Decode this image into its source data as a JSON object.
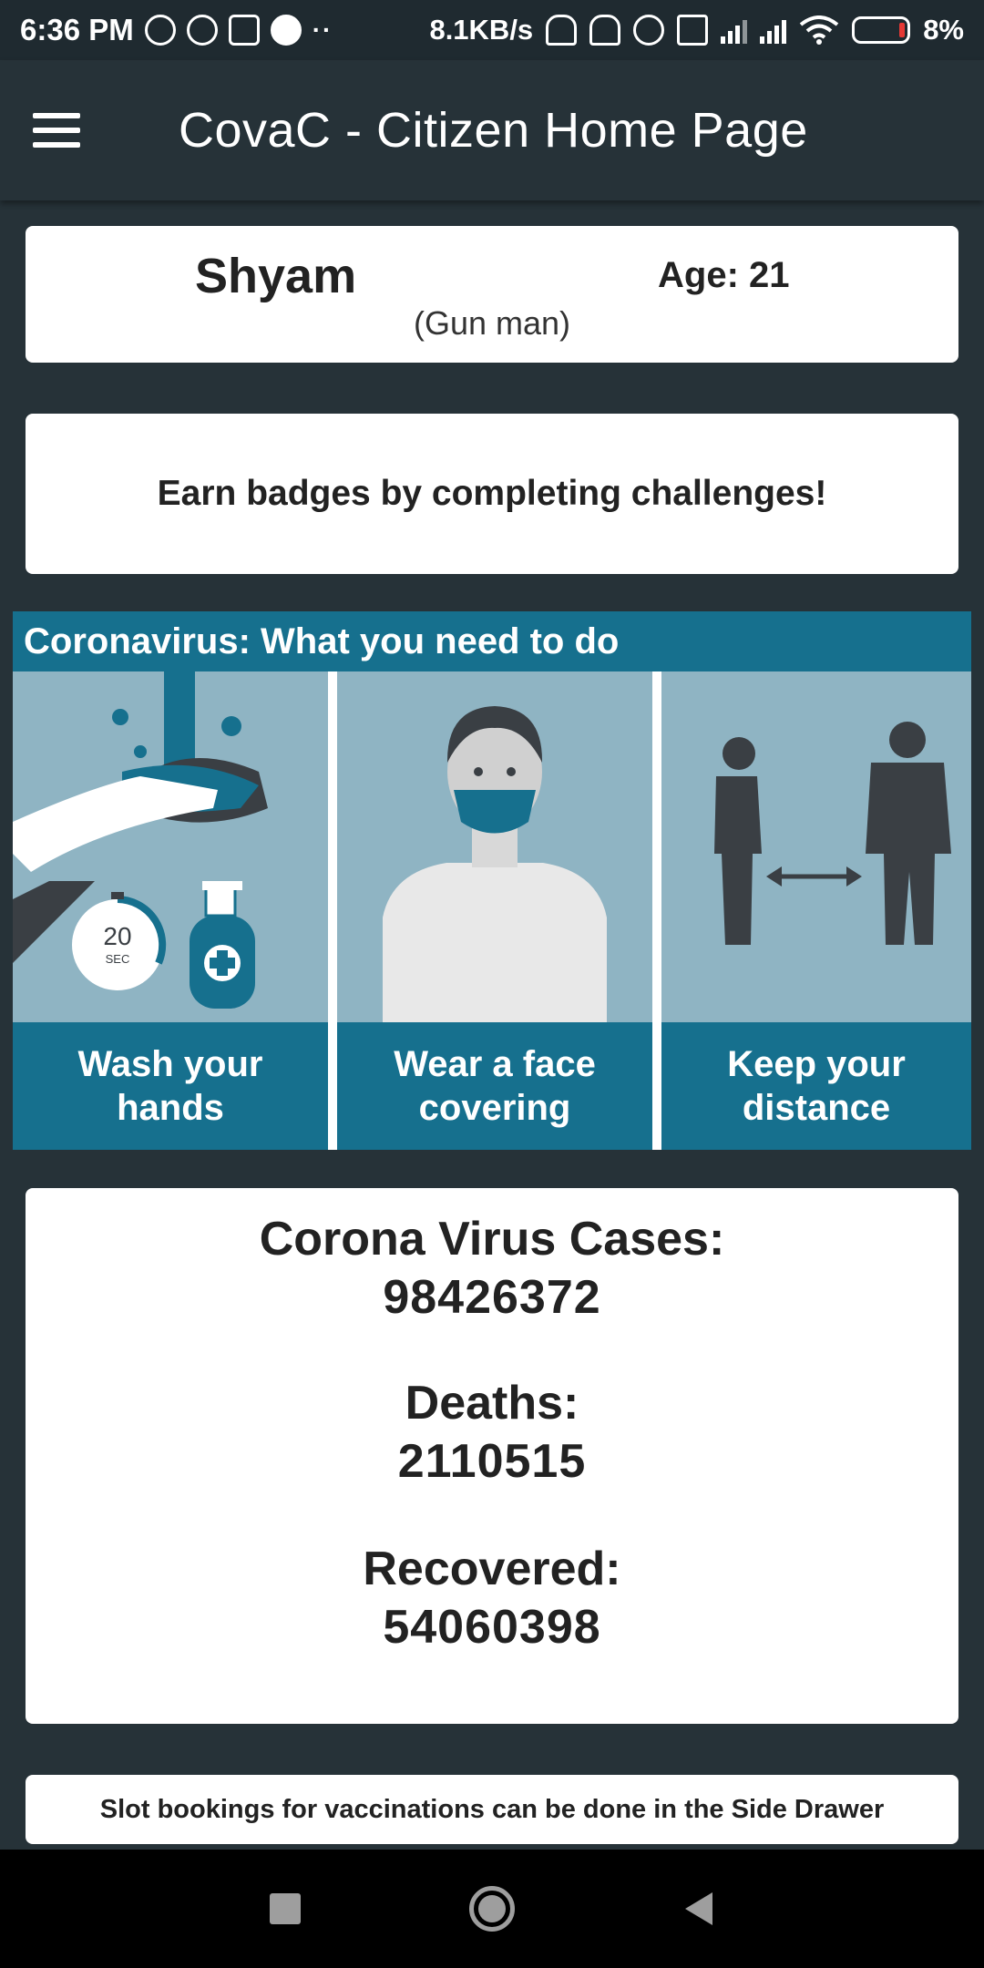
{
  "status_bar": {
    "time": "6:36 PM",
    "dots": "··",
    "net_speed": "8.1KB/s",
    "battery_pct": "8%",
    "icons": [
      "music-icon",
      "whatsapp-icon",
      "shield-icon",
      "call-icon",
      "headset-icon",
      "mute-icon",
      "alarm-icon",
      "volte-icon",
      "signal-icon",
      "4g-signal-icon",
      "wifi-icon",
      "battery-icon"
    ]
  },
  "app_bar": {
    "title": "CovaC - Citizen Home Page",
    "menu_icon": "hamburger-menu-icon"
  },
  "profile": {
    "name": "Shyam",
    "age": "Age: 21",
    "role": "(Gun man)"
  },
  "badges": {
    "text": "Earn  badges by completing challenges!"
  },
  "infographic": {
    "title": "Coronavirus: What you need to do",
    "panels": [
      {
        "caption": "Wash your hands",
        "timer_value": "20",
        "timer_unit": "SEC"
      },
      {
        "caption": "Wear a face covering"
      },
      {
        "caption": "Keep your distance"
      }
    ],
    "colors": {
      "header": "#16708e",
      "panel_bg": "#8fb4c3"
    }
  },
  "stats": {
    "cases_label": "Corona Virus Cases:",
    "cases_value": "98426372",
    "deaths_label": "Deaths:",
    "deaths_value": "2110515",
    "recovered_label": "Recovered:",
    "recovered_value": "54060398"
  },
  "footer": {
    "text": "Slot bookings for vaccinations can be done in the Side Drawer"
  },
  "nav_bar": {
    "buttons": [
      "recents-icon",
      "home-icon",
      "back-icon"
    ]
  },
  "colors": {
    "background": "#263238",
    "card": "#ffffff"
  }
}
